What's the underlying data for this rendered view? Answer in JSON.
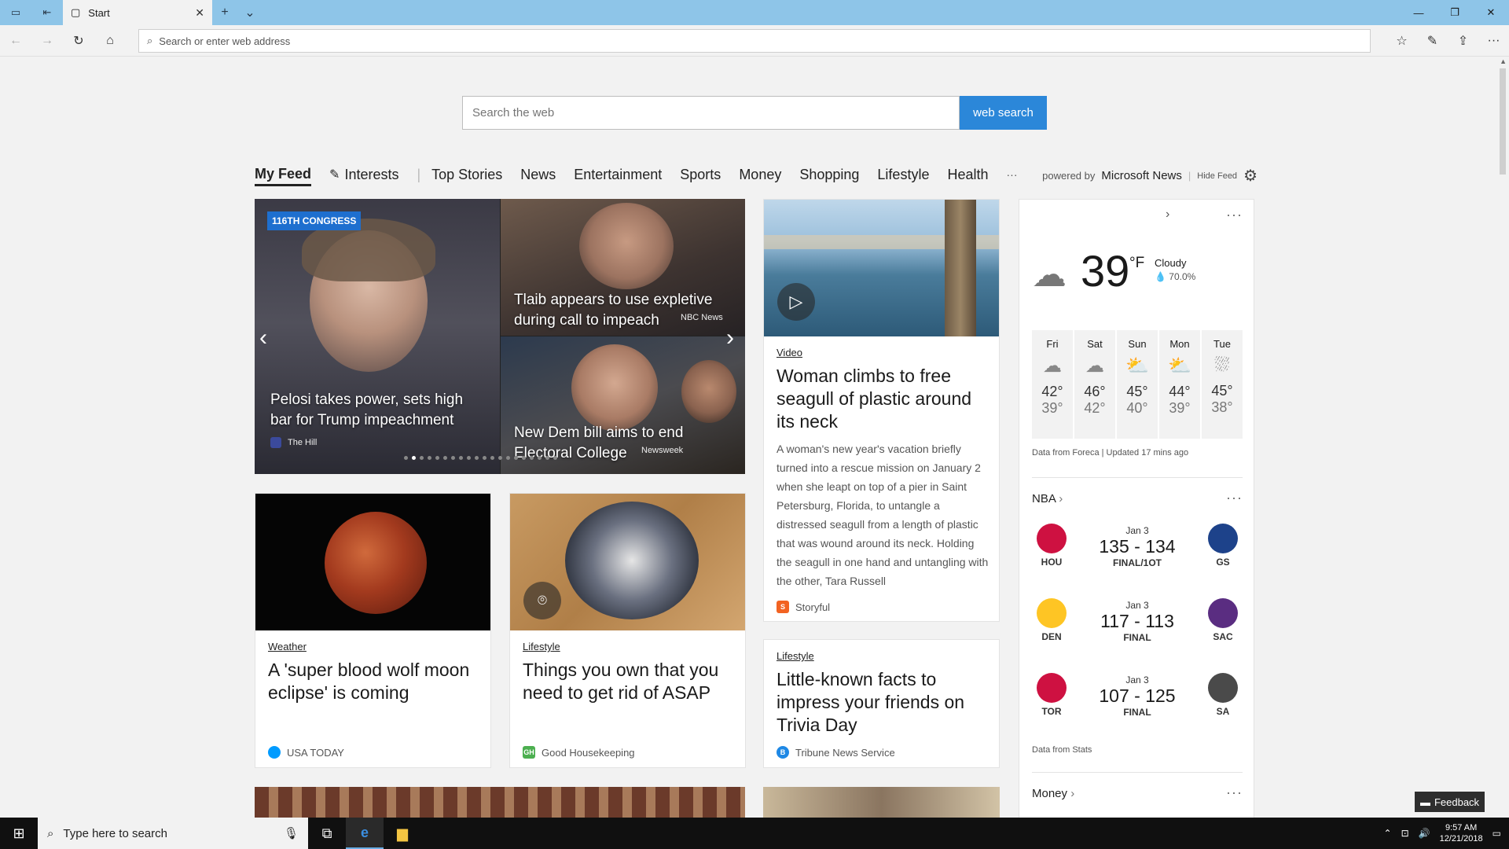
{
  "browser": {
    "tab_title": "Start",
    "address_placeholder": "Search or enter web address"
  },
  "search": {
    "placeholder": "Search the web",
    "button": "web search"
  },
  "feed_nav": {
    "items": [
      "My Feed",
      "Interests",
      "Top Stories",
      "News",
      "Entertainment",
      "Sports",
      "Money",
      "Shopping",
      "Lifestyle",
      "Health",
      "···"
    ],
    "powered_by": "powered by",
    "brand": "Microsoft News",
    "hide_feed": "Hide Feed"
  },
  "hero": {
    "badge": "116TH CONGRESS",
    "main_title": "Pelosi takes power, sets high bar for Trump impeachment",
    "main_source": "The Hill",
    "top_title": "Tlaib appears to use expletive during call to impeach",
    "top_source": "NBC News",
    "bottom_title": "New Dem bill aims to end Electoral College",
    "bottom_source": "Newsweek",
    "dot_count": 20,
    "active_dot": 1
  },
  "video_card": {
    "category": "Video",
    "title": "Woman climbs to free seagull of plastic around its neck",
    "desc": "A woman's new year's vacation briefly turned into a rescue mission on January 2 when she leapt on top of a pier in Saint Petersburg, Florida, to untangle a distressed seagull from a length of plastic that was wound around its neck. Holding the seagull in one hand and untangling with the other, Tara Russell",
    "source": "Storyful"
  },
  "cards": [
    {
      "category": "Weather",
      "title": "A 'super blood wolf moon eclipse' is coming",
      "source": "USA TODAY"
    },
    {
      "category": "Lifestyle",
      "title": "Things you own that you need to get rid of ASAP",
      "source": "Good Housekeeping"
    },
    {
      "category": "Lifestyle",
      "title": "Little-known facts to impress your friends on Trivia Day",
      "source": "Tribune News Service"
    }
  ],
  "weather": {
    "temp": "39",
    "unit": "°F",
    "condition": "Cloudy",
    "humidity": "70.0%",
    "forecast": [
      {
        "day": "Fri",
        "hi": "42°",
        "lo": "39°",
        "icon": "cloud-icon"
      },
      {
        "day": "Sat",
        "hi": "46°",
        "lo": "42°",
        "icon": "cloud-icon"
      },
      {
        "day": "Sun",
        "hi": "45°",
        "lo": "40°",
        "icon": "partly-sunny-icon"
      },
      {
        "day": "Mon",
        "hi": "44°",
        "lo": "39°",
        "icon": "partly-sunny-icon"
      },
      {
        "day": "Tue",
        "hi": "45°",
        "lo": "38°",
        "icon": "rain-icon"
      }
    ],
    "note": "Data from Foreca | Updated 17 mins ago"
  },
  "nba": {
    "header": "NBA",
    "games": [
      {
        "date": "Jan 3",
        "score": "135 - 134",
        "status": "FINAL/1OT",
        "home": "HOU",
        "away": "GS",
        "home_color": "#ce1141",
        "away_color": "#1d428a"
      },
      {
        "date": "Jan 3",
        "score": "117 - 113",
        "status": "FINAL",
        "home": "DEN",
        "away": "SAC",
        "home_color": "#fec524",
        "away_color": "#5a2d81"
      },
      {
        "date": "Jan 3",
        "score": "107 - 125",
        "status": "FINAL",
        "home": "TOR",
        "away": "SA",
        "home_color": "#ce1141",
        "away_color": "#4a4a4a"
      }
    ],
    "note": "Data from Stats"
  },
  "money": {
    "header": "Money"
  },
  "feedback": "Feedback",
  "taskbar": {
    "search_placeholder": "Type here to search",
    "time": "9:57 AM",
    "date": "12/21/2018"
  }
}
